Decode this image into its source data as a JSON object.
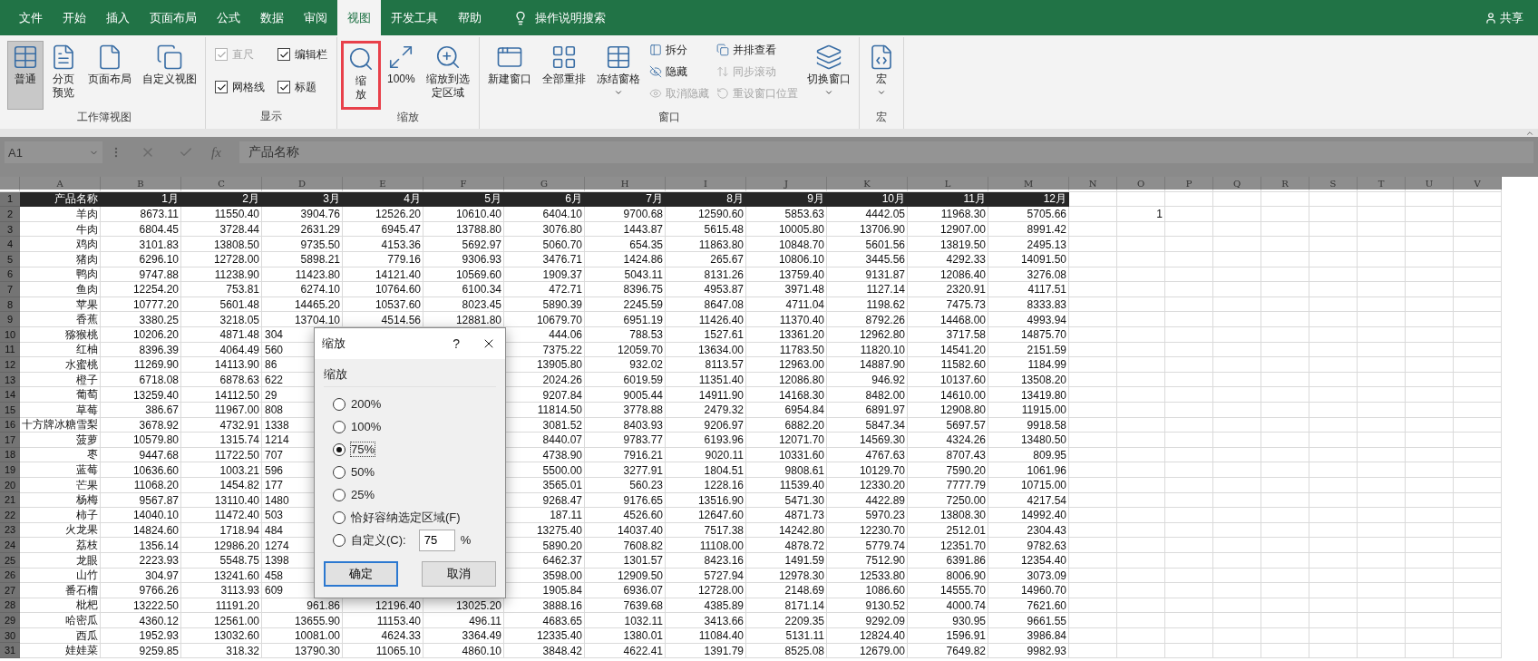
{
  "menu_tabs": [
    {
      "label": "文件",
      "selected": false
    },
    {
      "label": "开始",
      "selected": false
    },
    {
      "label": "插入",
      "selected": false
    },
    {
      "label": "页面布局",
      "selected": false
    },
    {
      "label": "公式",
      "selected": false
    },
    {
      "label": "数据",
      "selected": false
    },
    {
      "label": "审阅",
      "selected": false
    },
    {
      "label": "视图",
      "selected": true
    },
    {
      "label": "开发工具",
      "selected": false
    },
    {
      "label": "帮助",
      "selected": false
    }
  ],
  "search": {
    "label": "操作说明搜索"
  },
  "share": {
    "label": "共享"
  },
  "ribbon_groups": [
    {
      "title": "工作簿视图",
      "columns": [
        [
          {
            "kind": "large",
            "label": "普通",
            "selected": true
          }
        ],
        [
          {
            "kind": "large",
            "label": "分页预览",
            "selected": false
          }
        ],
        [
          {
            "kind": "large",
            "label": "页面布局",
            "selected": false
          }
        ],
        [
          {
            "kind": "large",
            "label": "自定义视图",
            "selected": false
          }
        ]
      ]
    },
    {
      "title": "显示",
      "columns": [
        [
          {
            "kind": "check",
            "label": "直尺",
            "checked": true,
            "disabled": true
          },
          {
            "kind": "check",
            "label": "网格线",
            "checked": true,
            "disabled": false
          }
        ],
        [
          {
            "kind": "check",
            "label": "编辑栏",
            "checked": true,
            "disabled": false
          },
          {
            "kind": "check",
            "label": "标题",
            "checked": true,
            "disabled": false
          }
        ]
      ]
    },
    {
      "title": "缩放",
      "columns": [
        [
          {
            "kind": "large",
            "label": "缩放",
            "highlighted": true
          }
        ],
        [
          {
            "kind": "large",
            "label": "100%",
            "highlighted": false
          }
        ],
        [
          {
            "kind": "large",
            "label": "缩放到选定区域",
            "highlighted": false
          }
        ]
      ]
    },
    {
      "title": "窗口",
      "columns": [
        [
          {
            "kind": "large",
            "label": "新建窗口"
          }
        ],
        [
          {
            "kind": "large",
            "label": "全部重排"
          }
        ],
        [
          {
            "kind": "large",
            "label": "冻结窗格",
            "dropdown": true
          }
        ],
        [
          {
            "kind": "small",
            "label": "拆分",
            "disabled": false
          },
          {
            "kind": "small",
            "label": "隐藏",
            "disabled": false
          },
          {
            "kind": "small",
            "label": "取消隐藏",
            "disabled": true
          }
        ],
        [
          {
            "kind": "small",
            "label": "并排查看",
            "disabled": false
          },
          {
            "kind": "small",
            "label": "同步滚动",
            "disabled": true
          },
          {
            "kind": "small",
            "label": "重设窗口位置",
            "disabled": true
          }
        ],
        [
          {
            "kind": "large",
            "label": "切换窗口",
            "dropdown": true
          }
        ]
      ]
    },
    {
      "title": "宏",
      "columns": [
        [
          {
            "kind": "large",
            "label": "宏",
            "dropdown": true
          }
        ]
      ]
    }
  ],
  "formula_bar": {
    "name_box": "A1",
    "function_label": "fx",
    "content": "产品名称"
  },
  "sheet": {
    "columns": [
      "A",
      "B",
      "C",
      "D",
      "E",
      "F",
      "G",
      "H",
      "I",
      "J",
      "K",
      "L",
      "M",
      "N",
      "O",
      "P",
      "Q",
      "R",
      "S",
      "T",
      "U",
      "V"
    ],
    "header_row": {
      "number": "1",
      "cells": [
        "产品名称",
        "1月",
        "2月",
        "3月",
        "4月",
        "5月",
        "6月",
        "7月",
        "8月",
        "9月",
        "10月",
        "11月",
        "12月"
      ]
    },
    "rows": [
      {
        "number": "2",
        "cells": [
          "羊肉",
          "8673.11",
          "11550.40",
          "3904.76",
          "12526.20",
          "10610.40",
          "6404.10",
          "9700.68",
          "12590.60",
          "5853.63",
          "4442.05",
          "11968.30",
          "5705.66",
          null,
          "1"
        ]
      },
      {
        "number": "3",
        "cells": [
          "牛肉",
          "6804.45",
          "3728.44",
          "2631.29",
          "6945.47",
          "13788.80",
          "3076.80",
          "1443.87",
          "5615.48",
          "10005.80",
          "13706.90",
          "12907.00",
          "8991.42"
        ]
      },
      {
        "number": "4",
        "cells": [
          "鸡肉",
          "3101.83",
          "13808.50",
          "9735.50",
          "4153.36",
          "5692.97",
          "5060.70",
          "654.35",
          "11863.80",
          "10848.70",
          "5601.56",
          "13819.50",
          "2495.13"
        ]
      },
      {
        "number": "5",
        "cells": [
          "猪肉",
          "6296.10",
          "12728.00",
          "5898.21",
          "779.16",
          "9306.93",
          "3476.71",
          "1424.86",
          "265.67",
          "10806.10",
          "3445.56",
          "4292.33",
          "14091.50"
        ]
      },
      {
        "number": "6",
        "cells": [
          "鸭肉",
          "9747.88",
          "11238.90",
          "11423.80",
          "14121.40",
          "10569.60",
          "1909.37",
          "5043.11",
          "8131.26",
          "13759.40",
          "9131.87",
          "12086.40",
          "3276.08"
        ]
      },
      {
        "number": "7",
        "cells": [
          "鱼肉",
          "12254.20",
          "753.81",
          "6274.10",
          "10764.60",
          "6100.34",
          "472.71",
          "8396.75",
          "4953.87",
          "3971.48",
          "1127.14",
          "2320.91",
          "4117.51"
        ]
      },
      {
        "number": "8",
        "cells": [
          "苹果",
          "10777.20",
          "5601.48",
          "14465.20",
          "10537.60",
          "8023.45",
          "5890.39",
          "2245.59",
          "8647.08",
          "4711.04",
          "1198.62",
          "7475.73",
          "8333.83"
        ]
      },
      {
        "number": "9",
        "cells": [
          "香蕉",
          "3380.25",
          "3218.05",
          "13704.10",
          "4514.56",
          "12881.80",
          "10679.70",
          "6951.19",
          "11426.40",
          "11370.40",
          "8792.26",
          "14468.00",
          "4993.94"
        ]
      },
      {
        "number": "10",
        "cells": [
          "猕猴桃",
          "10206.20",
          "4871.48",
          "304",
          null,
          null,
          "444.06",
          "788.53",
          "1527.61",
          "13361.20",
          "12962.80",
          "3717.58",
          "14875.70"
        ]
      },
      {
        "number": "11",
        "cells": [
          "红柚",
          "8396.39",
          "4064.49",
          "560",
          null,
          null,
          "7375.22",
          "12059.70",
          "13634.00",
          "11783.50",
          "11820.10",
          "14541.20",
          "2151.59"
        ]
      },
      {
        "number": "12",
        "cells": [
          "水蜜桃",
          "11269.90",
          "14113.90",
          "86",
          null,
          null,
          "13905.80",
          "932.02",
          "8113.57",
          "12963.00",
          "14887.90",
          "11582.60",
          "1184.99"
        ]
      },
      {
        "number": "13",
        "cells": [
          "橙子",
          "6718.08",
          "6878.63",
          "622",
          null,
          null,
          "2024.26",
          "6019.59",
          "11351.40",
          "12086.80",
          "946.92",
          "10137.60",
          "13508.20"
        ]
      },
      {
        "number": "14",
        "cells": [
          "葡萄",
          "13259.40",
          "14112.50",
          "29",
          null,
          null,
          "9207.84",
          "9005.44",
          "14911.90",
          "14168.30",
          "8482.00",
          "14610.00",
          "13419.80"
        ]
      },
      {
        "number": "15",
        "cells": [
          "草莓",
          "386.67",
          "11967.00",
          "808",
          null,
          null,
          "11814.50",
          "3778.88",
          "2479.32",
          "6954.84",
          "6891.97",
          "12908.80",
          "11915.00"
        ]
      },
      {
        "number": "16",
        "cells": [
          "十方牌冰糖雪梨",
          "3678.92",
          "4732.91",
          "1338",
          null,
          null,
          "3081.52",
          "8403.93",
          "9206.97",
          "6882.20",
          "5847.34",
          "5697.57",
          "9918.58"
        ]
      },
      {
        "number": "17",
        "cells": [
          "菠萝",
          "10579.80",
          "1315.74",
          "1214",
          null,
          null,
          "8440.07",
          "9783.77",
          "6193.96",
          "12071.70",
          "14569.30",
          "4324.26",
          "13480.50"
        ]
      },
      {
        "number": "18",
        "cells": [
          "枣",
          "9447.68",
          "11722.50",
          "707",
          null,
          null,
          "4738.90",
          "7916.21",
          "9020.11",
          "10331.60",
          "4767.63",
          "8707.43",
          "809.95"
        ]
      },
      {
        "number": "19",
        "cells": [
          "蓝莓",
          "10636.60",
          "1003.21",
          "596",
          null,
          null,
          "5500.00",
          "3277.91",
          "1804.51",
          "9808.61",
          "10129.70",
          "7590.20",
          "1061.96"
        ]
      },
      {
        "number": "20",
        "cells": [
          "芒果",
          "11068.20",
          "1454.82",
          "177",
          null,
          null,
          "3565.01",
          "560.23",
          "1228.16",
          "11539.40",
          "12330.20",
          "7777.79",
          "10715.00"
        ]
      },
      {
        "number": "21",
        "cells": [
          "杨梅",
          "9567.87",
          "13110.40",
          "1480",
          null,
          null,
          "9268.47",
          "9176.65",
          "13516.90",
          "5471.30",
          "4422.89",
          "7250.00",
          "4217.54"
        ]
      },
      {
        "number": "22",
        "cells": [
          "柿子",
          "14040.10",
          "11472.40",
          "503",
          null,
          null,
          "187.11",
          "4526.60",
          "12647.60",
          "4871.73",
          "5970.23",
          "13808.30",
          "14992.40"
        ]
      },
      {
        "number": "23",
        "cells": [
          "火龙果",
          "14824.60",
          "1718.94",
          "484",
          null,
          null,
          "13275.40",
          "14037.40",
          "7517.38",
          "14242.80",
          "12230.70",
          "2512.01",
          "2304.43"
        ]
      },
      {
        "number": "24",
        "cells": [
          "荔枝",
          "1356.14",
          "12986.20",
          "1274",
          null,
          null,
          "5890.20",
          "7608.82",
          "11108.00",
          "4878.72",
          "5779.74",
          "12351.70",
          "9782.63"
        ]
      },
      {
        "number": "25",
        "cells": [
          "龙眼",
          "2223.93",
          "5548.75",
          "1398",
          null,
          null,
          "6462.37",
          "1301.57",
          "8423.16",
          "1491.59",
          "7512.90",
          "6391.86",
          "12354.40"
        ]
      },
      {
        "number": "26",
        "cells": [
          "山竹",
          "304.97",
          "13241.60",
          "458",
          null,
          null,
          "3598.00",
          "12909.50",
          "5727.94",
          "12978.30",
          "12533.80",
          "8006.90",
          "3073.09"
        ]
      },
      {
        "number": "27",
        "cells": [
          "番石榴",
          "9766.26",
          "3113.93",
          "609",
          null,
          null,
          "1905.84",
          "6936.07",
          "12728.00",
          "2148.69",
          "1086.60",
          "14555.70",
          "14960.70"
        ]
      },
      {
        "number": "28",
        "cells": [
          "枇杷",
          "13222.50",
          "11191.20",
          "961.86",
          "12196.40",
          "13025.20",
          "3888.16",
          "7639.68",
          "4385.89",
          "8171.14",
          "9130.52",
          "4000.74",
          "7621.60"
        ]
      },
      {
        "number": "29",
        "cells": [
          "哈密瓜",
          "4360.12",
          "12561.00",
          "13655.90",
          "11153.40",
          "496.11",
          "4683.65",
          "1032.11",
          "3413.66",
          "2209.35",
          "9292.09",
          "930.95",
          "9661.55"
        ]
      },
      {
        "number": "30",
        "cells": [
          "西瓜",
          "1952.93",
          "13032.60",
          "10081.00",
          "4624.33",
          "3364.49",
          "12335.40",
          "1380.01",
          "11084.40",
          "5131.11",
          "12824.40",
          "1596.91",
          "3986.84"
        ]
      },
      {
        "number": "31",
        "cells": [
          "娃娃菜",
          "9259.85",
          "318.32",
          "13790.30",
          "11065.10",
          "4860.10",
          "3848.42",
          "4622.41",
          "1391.79",
          "8525.08",
          "12679.00",
          "7649.82",
          "9982.93"
        ]
      }
    ]
  },
  "zoom_dialog": {
    "title": "缩放",
    "help": "?",
    "group_label": "缩放",
    "options": [
      {
        "kind": "preset",
        "label": "200%",
        "selected": false
      },
      {
        "kind": "preset",
        "label": "100%",
        "selected": false
      },
      {
        "kind": "preset",
        "label": "75%",
        "selected": true
      },
      {
        "kind": "preset",
        "label": "50%",
        "selected": false
      },
      {
        "kind": "preset",
        "label": "25%",
        "selected": false
      },
      {
        "kind": "preset",
        "label": "恰好容纳选定区域(F)",
        "selected": false
      },
      {
        "kind": "custom",
        "label": "自定义(C):",
        "selected": false,
        "value": "75",
        "unit": "%"
      }
    ],
    "buttons": [
      {
        "label": "确定",
        "default": true
      },
      {
        "label": "取消",
        "default": false
      }
    ]
  }
}
